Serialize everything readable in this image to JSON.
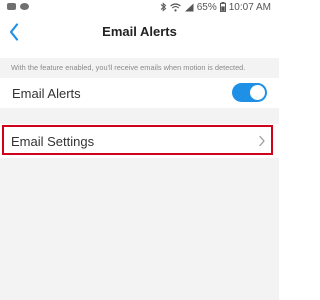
{
  "status_bar": {
    "battery_percent": "65%",
    "time": "10:07 AM"
  },
  "header": {
    "title": "Email Alerts"
  },
  "info": {
    "text": "With the feature enabled, you'll receive emails when motion is detected."
  },
  "toggle_row": {
    "label": "Email Alerts",
    "enabled": true
  },
  "settings_row": {
    "label": "Email Settings"
  },
  "colors": {
    "accent": "#1e90e6",
    "highlight": "#d0021b"
  }
}
